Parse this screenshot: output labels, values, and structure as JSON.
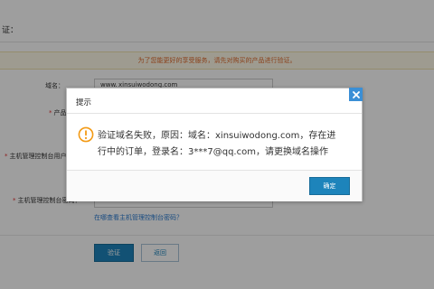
{
  "page": {
    "heading": "证：",
    "notice": "为了您能更好的享受服务，请先对购买的产品进行验证。",
    "form": {
      "domain_label": "域名：",
      "domain_prefix": "www.",
      "domain_value": "xinsuiwodong.com",
      "product_label": "产品",
      "host_label": "主机管理控制台用户名：",
      "password_label": "主机管理控制台密码：",
      "required_mark": "*",
      "forgot_link": "在哪查看主机管理控制台密码？"
    },
    "buttons": {
      "verify": "验证",
      "back": "返回"
    }
  },
  "dialog": {
    "title": "提示",
    "message": "验证域名失败，原因：域名：xinsuiwodong.com，存在进行中的订单，登录名：3***7@qq.com，请更换域名操作",
    "confirm": "确定"
  },
  "colors": {
    "accent": "#1d84bb",
    "notice_text": "#e06b2f",
    "warning": "#f39a14",
    "close_bg": "#3a8fd6"
  }
}
